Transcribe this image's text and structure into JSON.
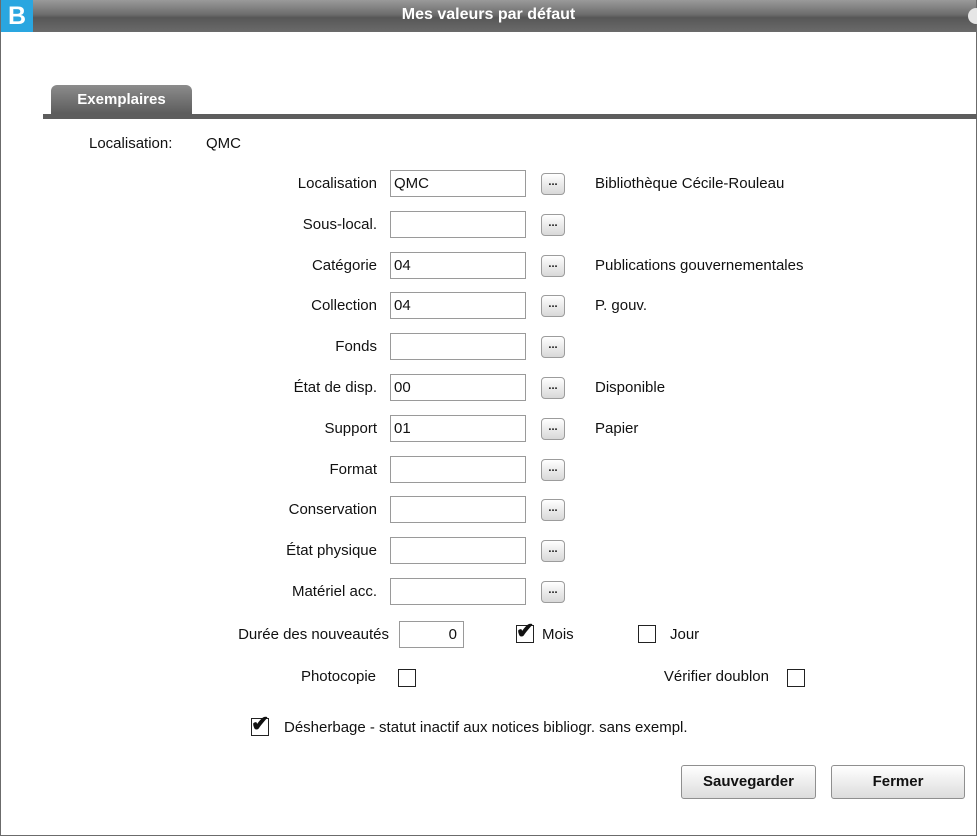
{
  "window": {
    "title": "Mes valeurs par défaut",
    "logo": "B"
  },
  "tabs": [
    {
      "label": "Exemplaires"
    }
  ],
  "summary": {
    "label": "Localisation:",
    "value": "QMC"
  },
  "fields": [
    {
      "label": "Localisation",
      "value": "QMC",
      "description": "Bibliothèque Cécile-Rouleau"
    },
    {
      "label": "Sous-local.",
      "value": "",
      "description": ""
    },
    {
      "label": "Catégorie",
      "value": "04",
      "description": "Publications gouvernementales"
    },
    {
      "label": "Collection",
      "value": "04",
      "description": "P. gouv."
    },
    {
      "label": "Fonds",
      "value": "",
      "description": ""
    },
    {
      "label": "État de disp.",
      "value": "00",
      "description": "Disponible"
    },
    {
      "label": "Support",
      "value": "01",
      "description": "Papier"
    },
    {
      "label": "Format",
      "value": "",
      "description": ""
    },
    {
      "label": "Conservation",
      "value": "",
      "description": ""
    },
    {
      "label": "État physique",
      "value": "",
      "description": ""
    },
    {
      "label": "Matériel acc.",
      "value": "",
      "description": ""
    }
  ],
  "ellipsis_label": "...",
  "duree": {
    "label": "Durée des nouveautés",
    "value": "0",
    "mois_label": "Mois",
    "mois_checked": true,
    "jour_label": "Jour",
    "jour_checked": false
  },
  "photocopie": {
    "label": "Photocopie",
    "checked": false
  },
  "doublon": {
    "label": "Vérifier doublon",
    "checked": false
  },
  "desherbage": {
    "label": "Désherbage - statut inactif aux notices bibliogr. sans exempl.",
    "checked": true
  },
  "buttons": {
    "save": "Sauvegarder",
    "close": "Fermer"
  },
  "checkmark_glyph": "✔"
}
